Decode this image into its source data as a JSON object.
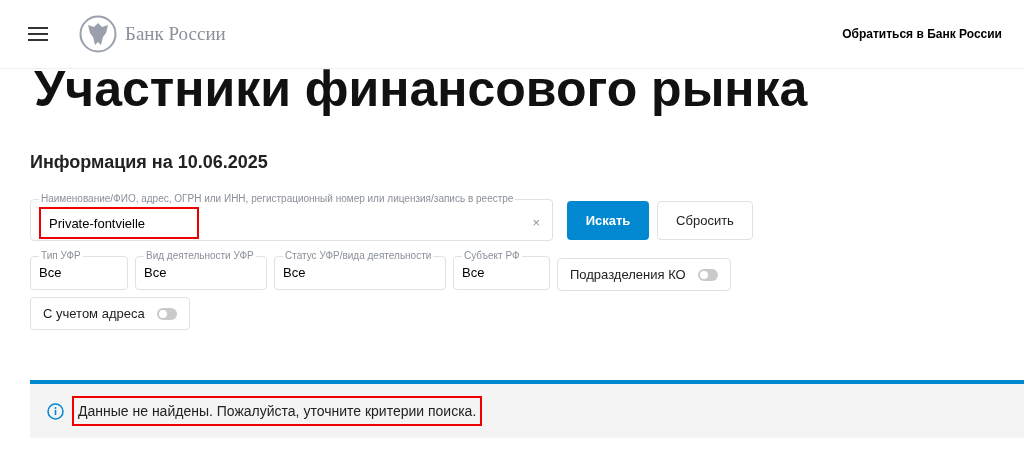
{
  "header": {
    "brand": "Банк России",
    "contact_link": "Обратиться в Банк России"
  },
  "page_title": "Участники финансового рынка",
  "info_heading": "Информация на 10.06.2025",
  "search": {
    "label": "Наименование/ФИО, адрес, ОГРН или ИНН, регистрационный номер или лицензия/запись в реестре",
    "value": "Private-fontvielle",
    "clear": "×",
    "highlighted": true
  },
  "buttons": [
    {
      "label": "Искать",
      "kind": "primary"
    },
    {
      "label": "Сбросить",
      "kind": "secondary"
    }
  ],
  "filters": [
    {
      "kind": "select",
      "label": "Тип УФР",
      "value": "Все"
    },
    {
      "kind": "select",
      "label": "Вид деятельности УФР",
      "value": "Все"
    },
    {
      "kind": "select",
      "label": "Статус УФР/вида деятельности",
      "value": "Все"
    },
    {
      "kind": "select",
      "label": "Субъект РФ",
      "value": "Все"
    },
    {
      "kind": "toggle",
      "label": "Подразделения КО",
      "on": false
    },
    {
      "kind": "toggle",
      "label": "С учетом адреса",
      "on": false
    }
  ],
  "message": {
    "text": "Данные не найдены. Пожалуйста, уточните критерии поиска.",
    "highlighted": true
  }
}
